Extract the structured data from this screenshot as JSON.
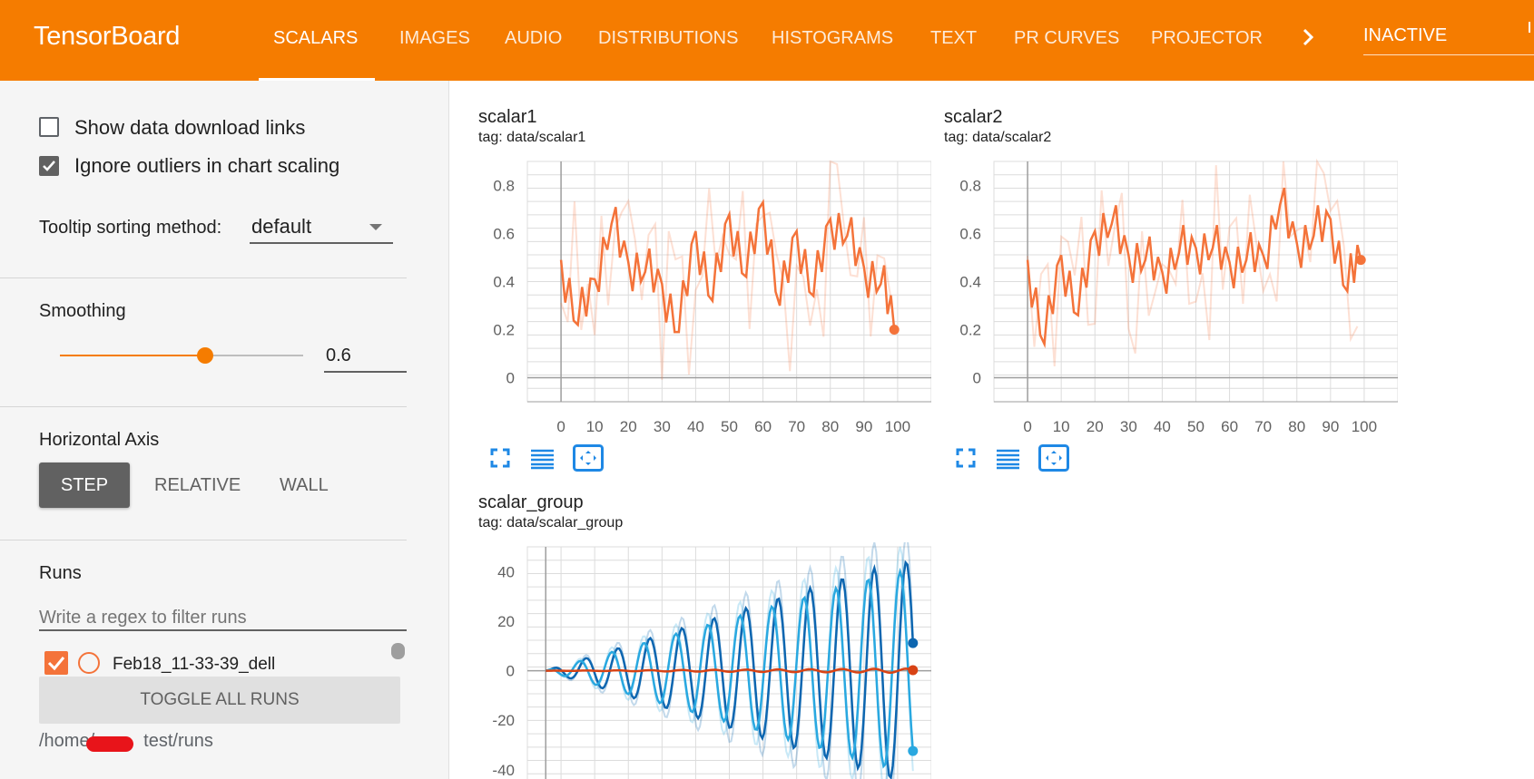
{
  "app": {
    "title": "TensorBoard"
  },
  "tabs": [
    "SCALARS",
    "IMAGES",
    "AUDIO",
    "DISTRIBUTIONS",
    "HISTOGRAMS",
    "TEXT",
    "PR CURVES",
    "PROJECTOR"
  ],
  "active_tab": "SCALARS",
  "status": "INACTIVE",
  "colors": {
    "brand": "#f57c00",
    "run_orange": "#f4733a",
    "blue_dark": "#1565c0",
    "blue_light": "#29b6f6"
  },
  "sidebar": {
    "show_download_label": "Show data download links",
    "show_download_checked": false,
    "ignore_outliers_label": "Ignore outliers in chart scaling",
    "ignore_outliers_checked": true,
    "tooltip_label": "Tooltip sorting method:",
    "tooltip_value": "default",
    "smoothing_label": "Smoothing",
    "smoothing_value": "0.6",
    "smoothing_fraction": 0.6,
    "horizontal_axis_label": "Horizontal Axis",
    "axis_options": [
      "STEP",
      "RELATIVE",
      "WALL"
    ],
    "axis_selected": "STEP",
    "runs_label": "Runs",
    "regex_placeholder": "Write a regex to filter runs",
    "run_name": "Feb18_11-33-39_dell",
    "toggle_all": "TOGGLE ALL RUNS",
    "path_prefix": "/home/",
    "path_suffix": "test/runs"
  },
  "cards": [
    {
      "title": "scalar1",
      "tag": "tag: data/scalar1"
    },
    {
      "title": "scalar2",
      "tag": "tag: data/scalar2"
    },
    {
      "title": "scalar_group",
      "tag": "tag: data/scalar_group"
    }
  ],
  "chart_data": [
    {
      "type": "line",
      "title": "scalar1",
      "x_ticks": [
        0,
        10,
        20,
        30,
        40,
        50,
        60,
        70,
        80,
        90,
        100
      ],
      "y_ticks": [
        0,
        0.2,
        0.4,
        0.6,
        0.8
      ],
      "xlim": [
        -10,
        110
      ],
      "ylim": [
        -0.1,
        0.9
      ],
      "series": [
        {
          "color": "#f4733a",
          "x": [
            0,
            5,
            10,
            15,
            20,
            25,
            30,
            35,
            40,
            45,
            50,
            55,
            60,
            65,
            70,
            75,
            80,
            85,
            90,
            95,
            99
          ],
          "y": [
            0.43,
            0.28,
            0.35,
            0.7,
            0.42,
            0.5,
            0.33,
            0.25,
            0.55,
            0.38,
            0.62,
            0.48,
            0.67,
            0.36,
            0.55,
            0.4,
            0.6,
            0.65,
            0.4,
            0.45,
            0.2
          ]
        }
      ],
      "grid": true
    },
    {
      "type": "line",
      "title": "scalar2",
      "x_ticks": [
        0,
        10,
        20,
        30,
        40,
        50,
        60,
        70,
        80,
        90,
        100
      ],
      "y_ticks": [
        0,
        0.2,
        0.4,
        0.6,
        0.8
      ],
      "xlim": [
        -10,
        110
      ],
      "ylim": [
        -0.1,
        0.9
      ],
      "series": [
        {
          "color": "#f4733a",
          "x": [
            0,
            5,
            10,
            15,
            20,
            25,
            30,
            35,
            40,
            45,
            50,
            55,
            60,
            65,
            70,
            75,
            80,
            85,
            90,
            95,
            99
          ],
          "y": [
            0.43,
            0.2,
            0.45,
            0.32,
            0.55,
            0.7,
            0.45,
            0.55,
            0.38,
            0.58,
            0.48,
            0.6,
            0.42,
            0.55,
            0.45,
            0.78,
            0.5,
            0.65,
            0.6,
            0.42,
            0.49
          ]
        }
      ],
      "grid": true
    },
    {
      "type": "line",
      "title": "scalar_group",
      "x_ticks": [],
      "y_ticks": [
        -40,
        -20,
        0,
        20,
        40
      ],
      "xlim": [
        -5,
        105
      ],
      "ylim": [
        -47,
        50
      ],
      "series": [
        {
          "color": "#0d66b0",
          "amplitude_end": 44,
          "phase": 0.0
        },
        {
          "color": "#29a8e0",
          "amplitude_end": 40,
          "phase": 1.2
        },
        {
          "color": "#d84315",
          "amplitude_end": 0.8,
          "phase": 0.0
        }
      ],
      "grid": true
    }
  ]
}
